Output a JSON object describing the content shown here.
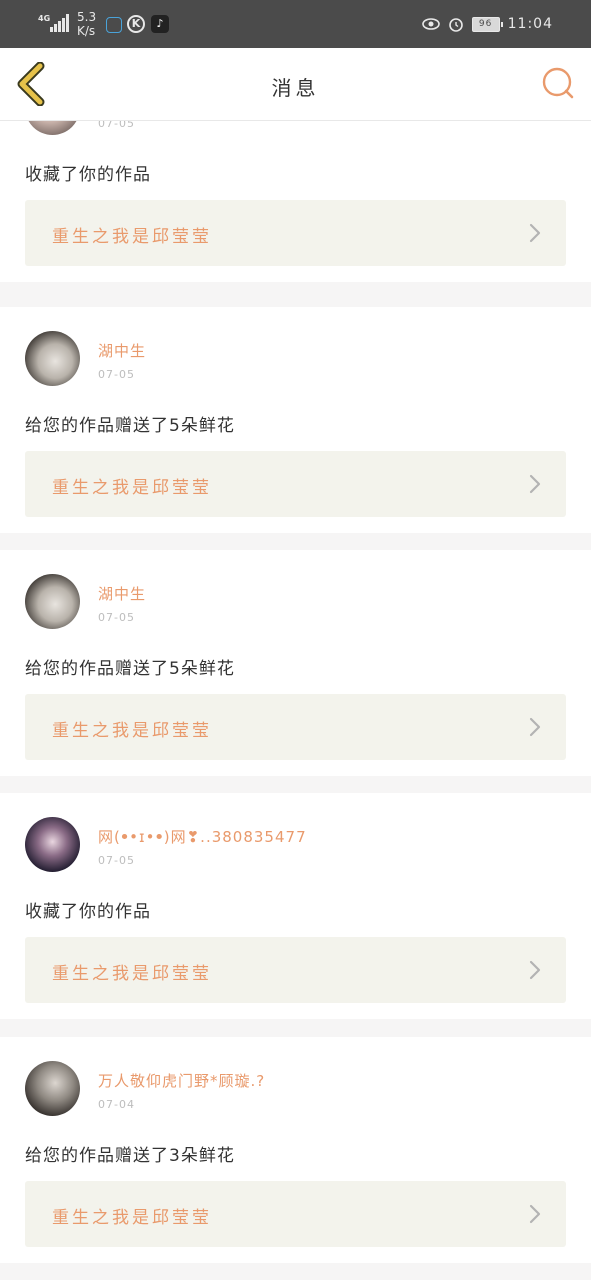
{
  "status_bar": {
    "network": "4G",
    "speed_value": "5.3",
    "speed_unit": "K/s",
    "time": "11:04",
    "battery": "96"
  },
  "header": {
    "title": "消息"
  },
  "colors": {
    "accent": "#e99a6c",
    "back_arrow": "#e6c24a",
    "card_link_bg": "#f3f3ec"
  },
  "messages": [
    {
      "username": "",
      "date": "07-05",
      "action": "收藏了你的作品",
      "work_title": "重生之我是邱莹莹"
    },
    {
      "username": "湖中生",
      "date": "07-05",
      "action": "给您的作品赠送了5朵鲜花",
      "work_title": "重生之我是邱莹莹"
    },
    {
      "username": "湖中生",
      "date": "07-05",
      "action": "给您的作品赠送了5朵鲜花",
      "work_title": "重生之我是邱莹莹"
    },
    {
      "username": "网(ꔷ•ɪ•ꔷ)网❣..380835477",
      "date": "07-05",
      "action": "收藏了你的作品",
      "work_title": "重生之我是邱莹莹"
    },
    {
      "username": "万人敬仰虎门野*顾璇.?",
      "date": "07-04",
      "action": "给您的作品赠送了3朵鲜花",
      "work_title": "重生之我是邱莹莹"
    }
  ]
}
